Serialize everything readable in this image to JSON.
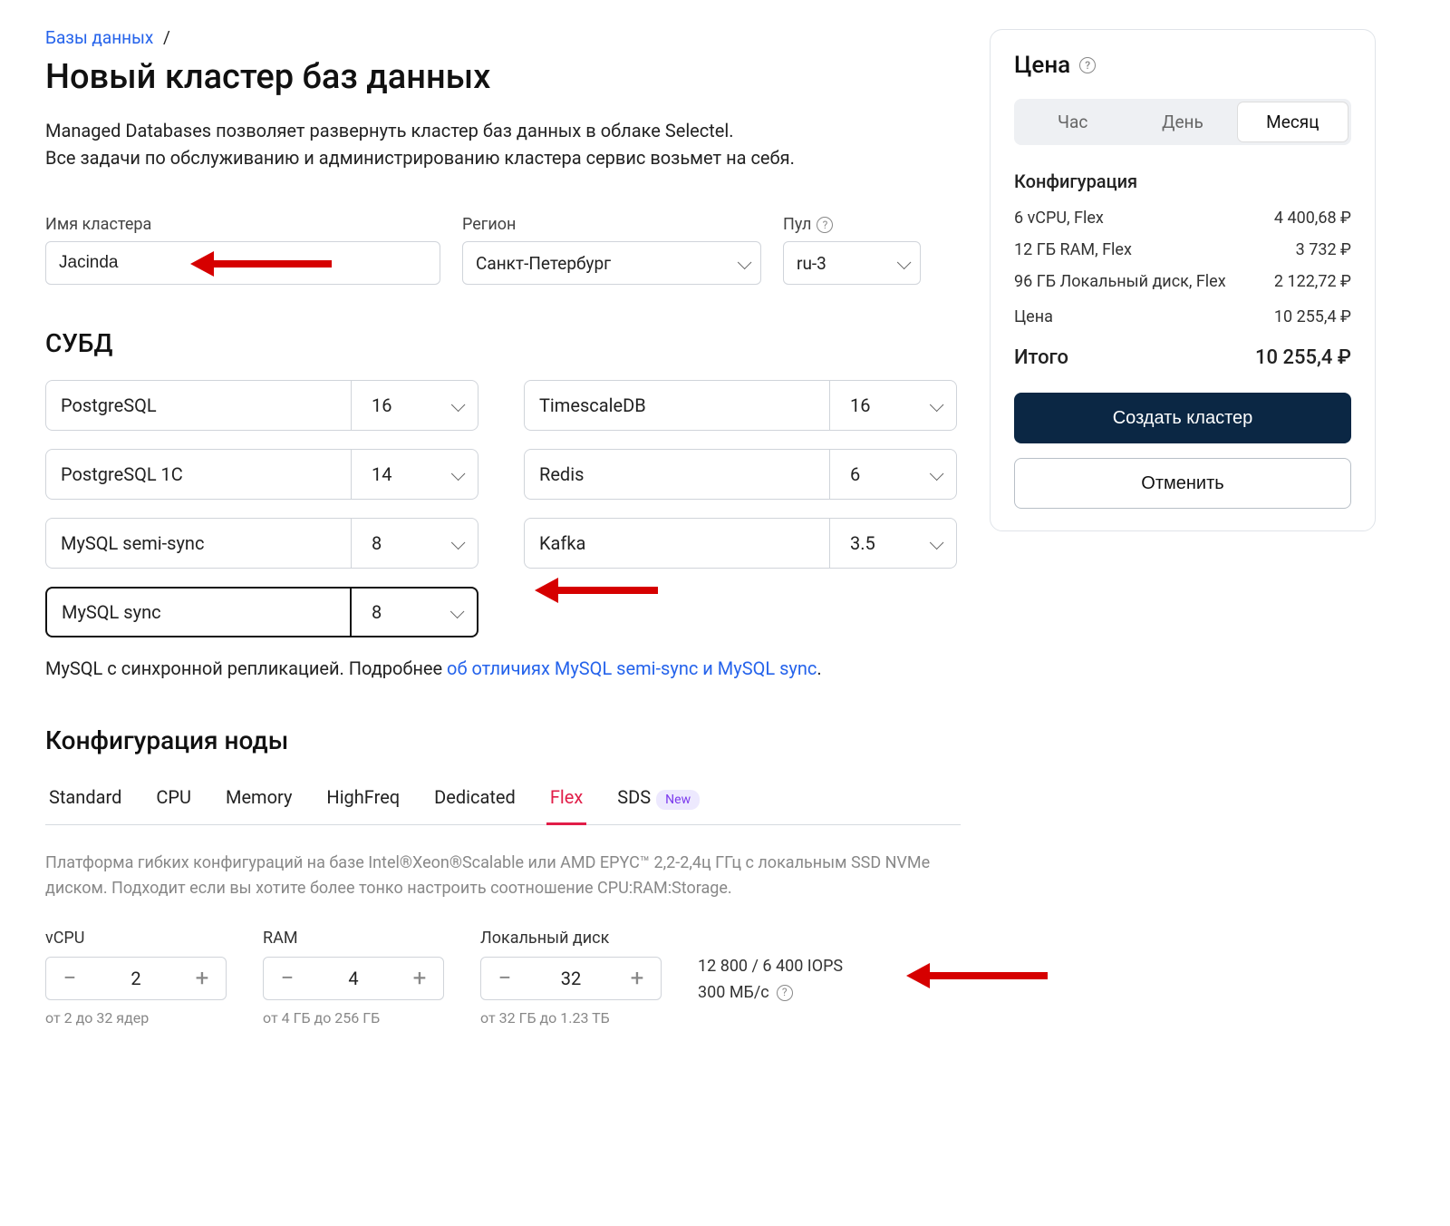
{
  "breadcrumb": {
    "root": "Базы данных"
  },
  "title": "Новый кластер баз данных",
  "intro1": "Managed Databases позволяет развернуть кластер баз данных в облаке Selectel.",
  "intro2": "Все задачи по обслуживанию и администрированию кластера сервис возьмет на себя.",
  "fields": {
    "name_label": "Имя кластера",
    "name_value": "Jacinda",
    "region_label": "Регион",
    "region_value": "Санкт-Петербург",
    "pool_label": "Пул",
    "pool_value": "ru-3"
  },
  "dbms_section": "СУБД",
  "dbms": [
    {
      "name": "PostgreSQL",
      "ver": "16"
    },
    {
      "name": "TimescaleDB",
      "ver": "16"
    },
    {
      "name": "PostgreSQL 1C",
      "ver": "14"
    },
    {
      "name": "Redis",
      "ver": "6"
    },
    {
      "name": "MySQL semi-sync",
      "ver": "8"
    },
    {
      "name": "Kafka",
      "ver": "3.5"
    },
    {
      "name": "MySQL sync",
      "ver": "8",
      "selected": true
    }
  ],
  "dbms_desc_prefix": "MySQL с синхронной репликацией. Подробнее ",
  "dbms_desc_link": "об отличиях MySQL semi-sync и MySQL sync",
  "dbms_desc_suffix": ".",
  "node_section": "Конфигурация ноды",
  "tabs": [
    {
      "label": "Standard"
    },
    {
      "label": "CPU"
    },
    {
      "label": "Memory"
    },
    {
      "label": "HighFreq"
    },
    {
      "label": "Dedicated"
    },
    {
      "label": "Flex",
      "active": true
    },
    {
      "label": "SDS",
      "badge": "New"
    }
  ],
  "tab_desc": "Платформа гибких конфигураций на базе Intel®Xeon®Scalable или AMD EPYC™ 2,2-2,4ц ГГц с локальным SSD NVMe диском. Подходит если вы хотите более тонко настроить соотношение CPU:RAM:Storage.",
  "cfg": {
    "vcpu_label": "vCPU",
    "vcpu_value": "2",
    "vcpu_hint": "от 2 до 32 ядер",
    "ram_label": "RAM",
    "ram_value": "4",
    "ram_hint": "от 4 ГБ до 256 ГБ",
    "disk_label": "Локальный диск",
    "disk_value": "32",
    "disk_hint": "от 32 ГБ до 1.23 ТБ",
    "iops_line": "12 800 / 6 400 IOPS",
    "bw_line": "300 МБ/с"
  },
  "price": {
    "title": "Цена",
    "seg": {
      "hour": "Час",
      "day": "День",
      "month": "Месяц"
    },
    "config_label": "Конфигурация",
    "lines": [
      {
        "name": "6 vCPU, Flex",
        "value": "4 400,68 ₽"
      },
      {
        "name": "12 ГБ RAM, Flex",
        "value": "3 732 ₽"
      },
      {
        "name": "96 ГБ Локальный диск, Flex",
        "value": "2 122,72 ₽"
      }
    ],
    "subtotal_label": "Цена",
    "subtotal_value": "10 255,4 ₽",
    "total_label": "Итого",
    "total_value": "10 255,4 ₽",
    "create": "Создать кластер",
    "cancel": "Отменить"
  }
}
